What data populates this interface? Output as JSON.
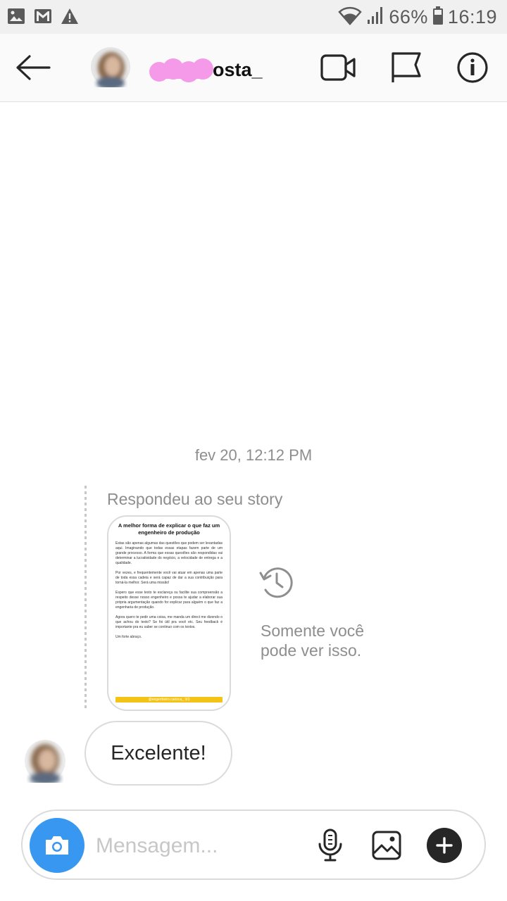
{
  "status_bar": {
    "battery": "66%",
    "time": "16:19",
    "icons_left": [
      "image-icon",
      "gmail-icon",
      "warning-icon"
    ],
    "icons_right": [
      "wifi-icon",
      "signal-icon",
      "battery-icon"
    ]
  },
  "header": {
    "username_visible": "osta_",
    "icons": [
      "back-arrow-icon",
      "video-call-icon",
      "flag-icon",
      "info-icon"
    ]
  },
  "thread": {
    "timestamp": "fev 20, 12:12 PM",
    "reply_label": "Respondeu ao seu story",
    "story": {
      "title": "A melhor forma de explicar o que faz um engenheiro de produção",
      "paragraphs": [
        "Estas são apenas algumas das questões que podem ser levantadas aqui. Imaginando que todas essas etapas fazem parte de um grande processo. A forma que essas questões são respondidas vai determinar a lucratividade do negócio, a velocidade de entrega e a qualidade.",
        "Por vezes, e frequentemente você vai atuar em apenas uma parte de toda essa cadeia e será capaz de dar a sua contribuição para torná-la melhor. Será uma missão!",
        "Espero que esse texto te esclareça ou facilite sua compreensão a respeito desse nosso engenheiro e possa te ajudar a elaborar sua própria argumentação quando for explicar para alguém o que faz a engenharia de produção.",
        "Agora quero te pedir uma coisa, me manda um direct me dizendo o que achou do texto? Se foi útil pra você etc. Seu feedback é importante pra eu saber se continuo com os textos.",
        "Um forte abraço."
      ],
      "footer": "@engenheiro.carioca_  3/3"
    },
    "only_you_text": "Somente você pode ver isso.",
    "message": "Excelente!"
  },
  "composer": {
    "placeholder": "Mensagem...",
    "icons": [
      "camera-icon",
      "microphone-icon",
      "gallery-icon",
      "plus-icon"
    ]
  },
  "colors": {
    "accent_blue": "#3897f0",
    "redaction_pink": "#f59ae8",
    "story_yellow": "#f5c316"
  }
}
